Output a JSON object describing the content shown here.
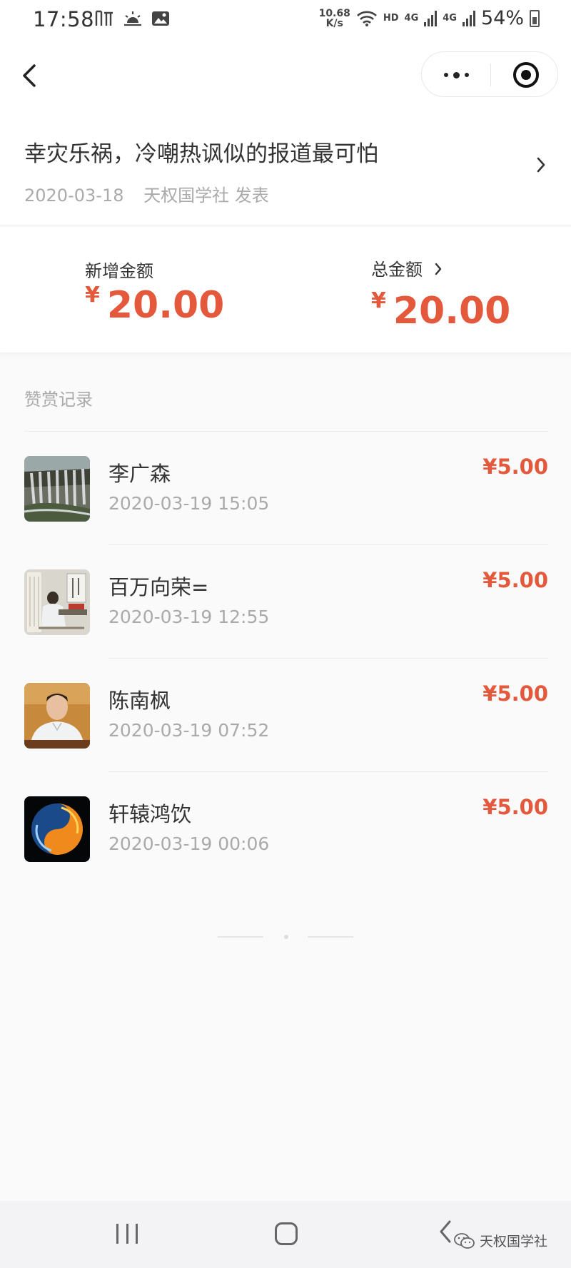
{
  "status_bar": {
    "time": "17:58",
    "network_speed_value": "10.68",
    "network_speed_unit": "K/s",
    "hd": "HD",
    "signal_1": "4G",
    "signal_2": "4G",
    "battery": "54%"
  },
  "article": {
    "title": "幸灾乐祸，冷嘲热讽似的报道最可怕",
    "date": "2020-03-18",
    "publisher": "天权国学社 发表"
  },
  "amounts": {
    "new_label": "新增金额",
    "new_currency": "¥",
    "new_value": "20.00",
    "total_label": "总金额",
    "total_currency": "¥",
    "total_value": "20.00"
  },
  "records": {
    "title": "赞赏记录",
    "items": [
      {
        "name": "李广森",
        "time": "2020-03-19 15:05",
        "amount": "¥5.00",
        "avatar": "waterfall-photo"
      },
      {
        "name": "百万向荣=",
        "time": "2020-03-19 12:55",
        "amount": "¥5.00",
        "avatar": "painting-photo"
      },
      {
        "name": "陈南枫",
        "time": "2020-03-19 07:52",
        "amount": "¥5.00",
        "avatar": "portrait-photo"
      },
      {
        "name": "轩辕鸿饮",
        "time": "2020-03-19 00:06",
        "amount": "¥5.00",
        "avatar": "yin-yang-fire-ice"
      }
    ]
  },
  "watermark": "天权国学社",
  "colors": {
    "accent": "#e4593b",
    "muted_text": "#aaaaaa",
    "primary_text": "#333333"
  }
}
